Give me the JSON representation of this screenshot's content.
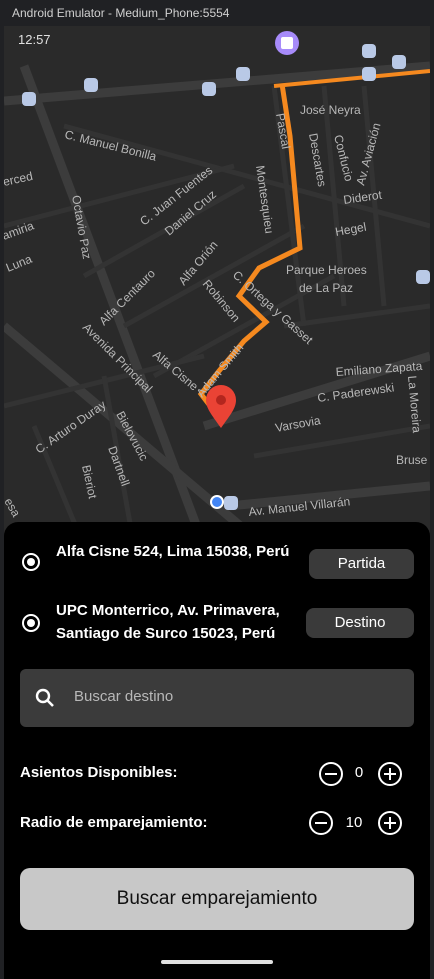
{
  "window": {
    "title": "Android Emulator - Medium_Phone:5554"
  },
  "status_bar": {
    "time": "12:57"
  },
  "map": {
    "streets": [
      "C. Manuel Bonilla",
      "José Neyra",
      "Pascal",
      "Descartes",
      "Confucio",
      "Av. Aviación",
      "Diderot",
      "C. Juan Fuentes",
      "Daniel Cruz",
      "Octavio Paz",
      "Montesquieu",
      "Hegel",
      "Alfa Centauro",
      "Alfa Orión",
      "Robinson",
      "C. Ortega y Gasset",
      "Parque Heroes",
      "de La Paz",
      "Avenida Principal",
      "Alfa Cisne",
      "Adam Smith",
      "Emiliano Zapata",
      "C. Paderewski",
      "La Moreira",
      "C. Arturo Duray",
      "Bielovucic",
      "Varsovia",
      "Bruse",
      "Dartnell",
      "Bieriot",
      "Av. Manuel Villarán",
      "Luna",
      "amiria",
      "erced",
      "esa"
    ]
  },
  "origin": {
    "address": "Alfa Cisne 524, Lima 15038, Perú",
    "button": "Partida"
  },
  "destination": {
    "address": "UPC Monterrico, Av. Primavera, Santiago de Surco 15023, Perú",
    "button": "Destino"
  },
  "search": {
    "placeholder": "Buscar destino"
  },
  "seats": {
    "label": "Asientos Disponibles:",
    "value": "0"
  },
  "radius": {
    "label": "Radio de emparejamiento:",
    "value": "10"
  },
  "action": {
    "label": "Buscar emparejamiento"
  },
  "colors": {
    "route": "#f5891f",
    "pin": "#ea4335",
    "transit": "#a78bfa"
  }
}
